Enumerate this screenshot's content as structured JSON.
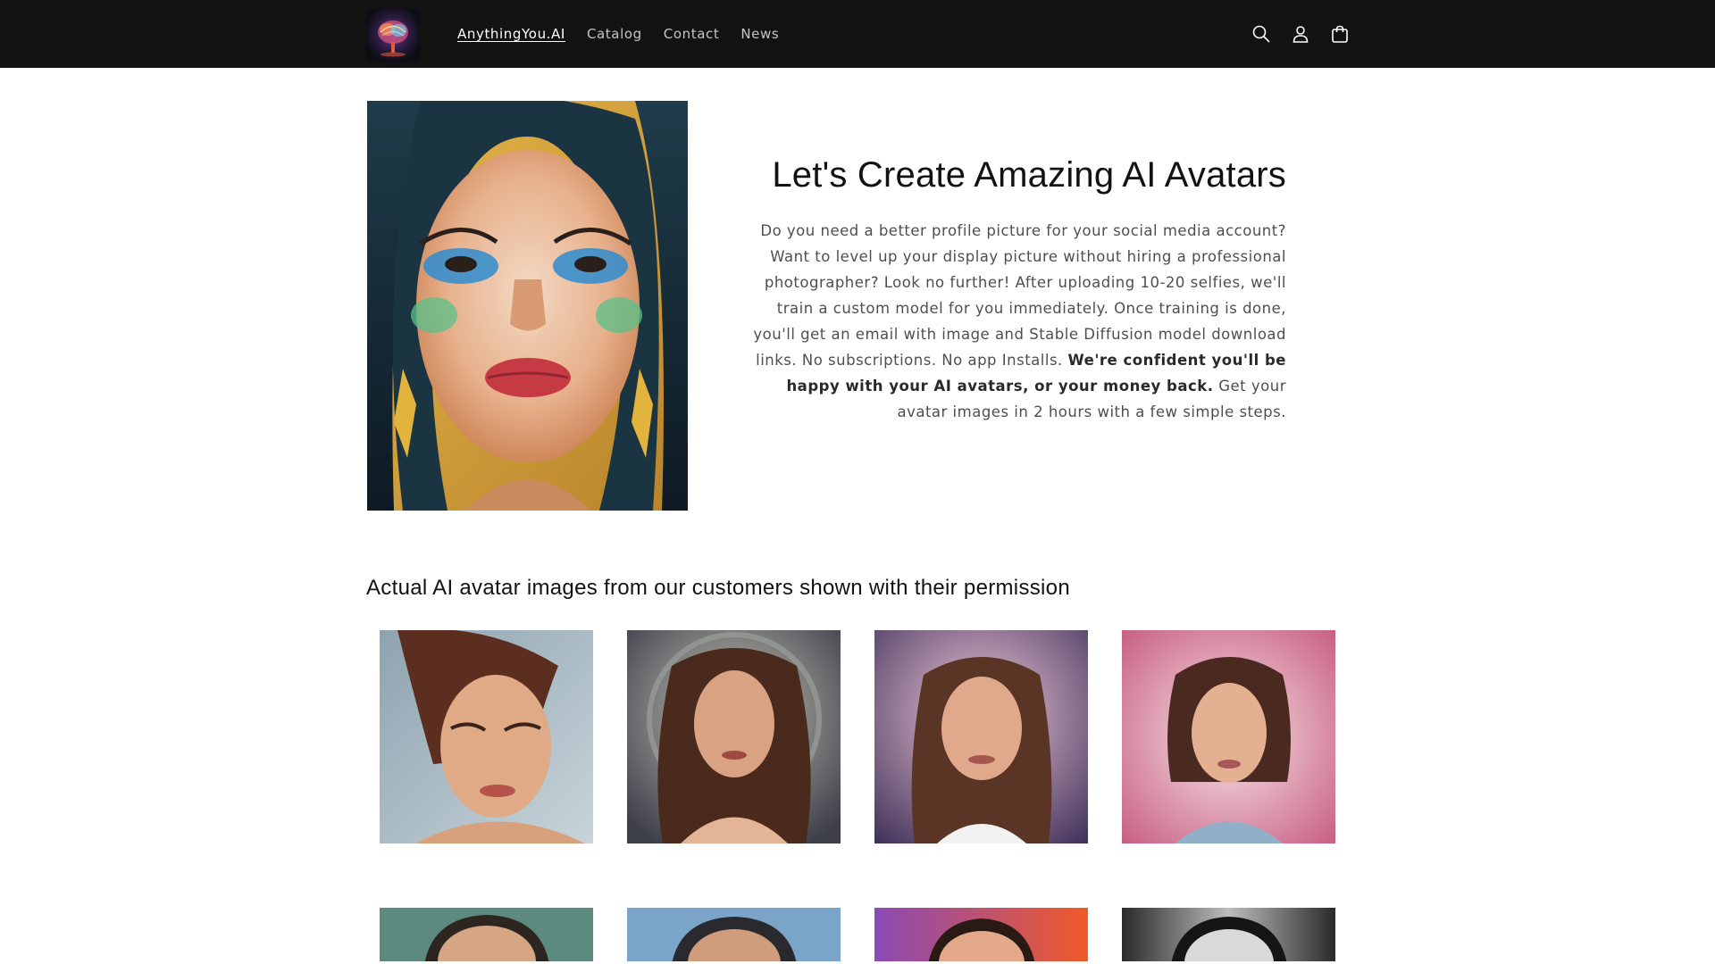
{
  "header": {
    "logo_icon": "brain-logo-icon",
    "nav": [
      {
        "label": "AnythingYou.AI",
        "active": true
      },
      {
        "label": "Catalog",
        "active": false
      },
      {
        "label": "Contact",
        "active": false
      },
      {
        "label": "News",
        "active": false
      }
    ],
    "icons": [
      "search-icon",
      "account-icon",
      "cart-icon"
    ]
  },
  "hero": {
    "title": "Let's Create Amazing AI Avatars",
    "description_part1": "Do you need a better profile picture for your social media account? Want to level up your display picture without hiring a professional photographer? Look no further! After uploading 10-20 selfies, we'll train a custom model for you immediately. Once training is done, you'll get an email with image and Stable Diffusion model download links. No subscriptions. No app Installs.",
    "description_bold": "We're confident you'll be happy with your AI avatars, or your money back.",
    "description_part2": "Get your avatar images in 2 hours with a few simple steps.",
    "image": "hero-avatar-woman-blue-eyeshadow"
  },
  "gallery": {
    "heading": "Actual AI avatar images from our customers shown with their permission",
    "row1": [
      "avatar-woman-earrings",
      "avatar-woman-halo",
      "avatar-woman-pink-glow",
      "avatar-woman-short-hair"
    ],
    "row2": [
      "avatar-man-teal",
      "avatar-man-sky",
      "avatar-man-sunset",
      "avatar-man-monochrome"
    ]
  },
  "colors": {
    "header_bg": "#121212",
    "page_bg": "#ffffff",
    "text": "#121212"
  }
}
